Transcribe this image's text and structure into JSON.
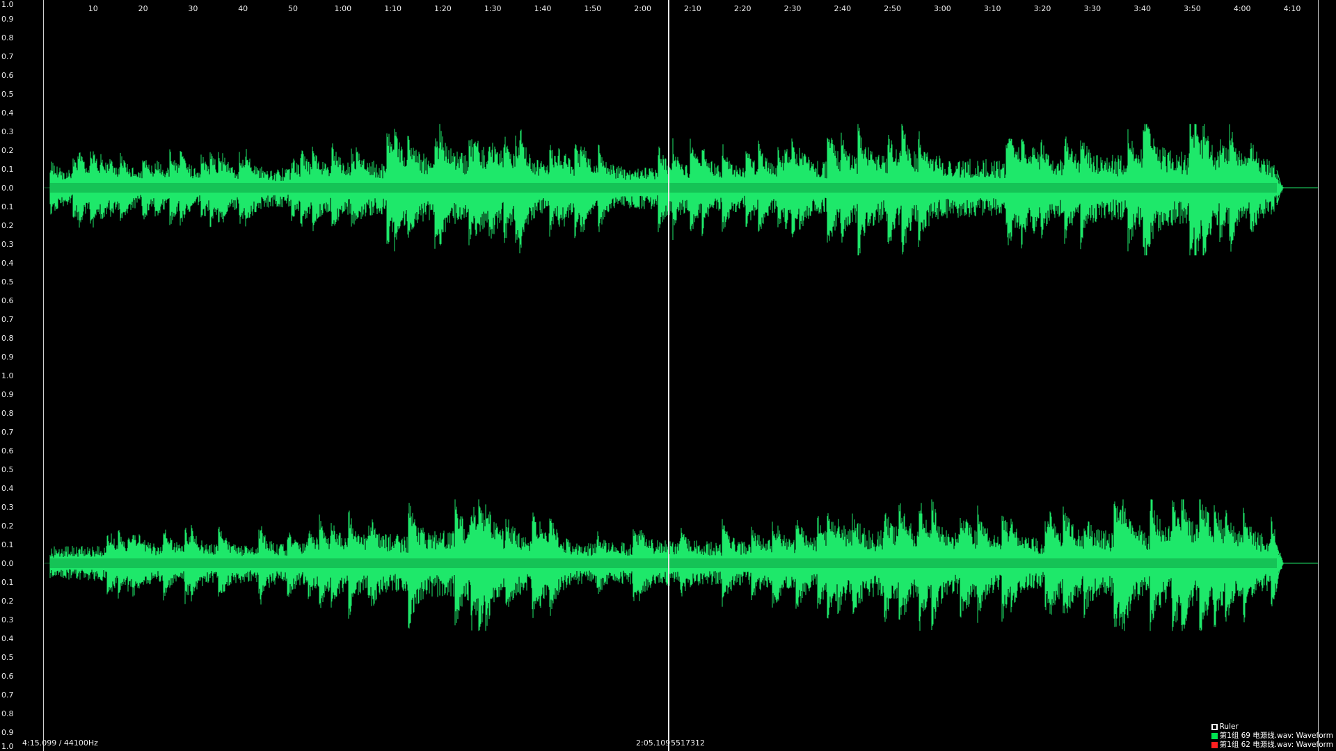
{
  "y_labels": [
    "1.0",
    "0.9",
    "0.8",
    "0.7",
    "0.6",
    "0.5",
    "0.4",
    "0.3",
    "0.2",
    "0.1",
    "0.0",
    "0.1",
    "0.2",
    "0.3",
    "0.4",
    "0.5",
    "0.6",
    "0.7",
    "0.8",
    "0.9",
    "1.0",
    "0.9",
    "0.8",
    "0.7",
    "0.6",
    "0.5",
    "0.4",
    "0.3",
    "0.2",
    "0.1",
    "0.0",
    "0.1",
    "0.2",
    "0.3",
    "0.4",
    "0.5",
    "0.6",
    "0.7",
    "0.8",
    "0.9",
    "1.0"
  ],
  "time_labels": [
    "10",
    "20",
    "30",
    "40",
    "50",
    "1:00",
    "1:10",
    "1:20",
    "1:30",
    "1:40",
    "1:50",
    "2:00",
    "2:10",
    "2:20",
    "2:30",
    "2:40",
    "2:50",
    "3:00",
    "3:10",
    "3:20",
    "3:30",
    "3:40",
    "3:50",
    "4:00",
    "4:10"
  ],
  "status": {
    "duration_rate": "4:15.099 / 44100Hz",
    "cursor_time": "2:05.109",
    "cursor_sample": "5517312"
  },
  "legend": [
    {
      "label": "Ruler",
      "color": "#ffffff",
      "style": "outline"
    },
    {
      "label": "第1组 69 电源线.wav: Waveform",
      "color": "#00e050",
      "style": "fill"
    },
    {
      "label": "第1组 62 电源线.wav: Waveform",
      "color": "#ff2020",
      "style": "fill"
    }
  ],
  "colors": {
    "background": "#000000",
    "waveform": "#1ee86a",
    "waveform_dense": "#0fa445"
  }
}
